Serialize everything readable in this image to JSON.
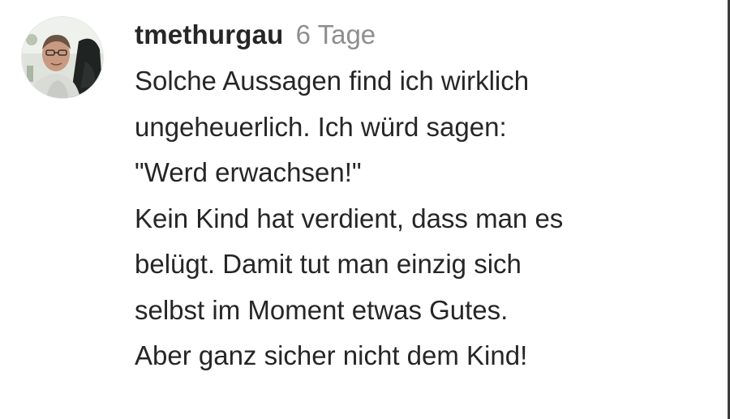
{
  "comment": {
    "username": "tmethurgau",
    "timestamp": "6 Tage",
    "avatar_icon": "user-avatar-photo",
    "text_lines": [
      "Solche Aussagen find ich wirklich",
      "ungeheuerlich. Ich würd sagen:",
      "\"Werd erwachsen!\"",
      "Kein Kind hat verdient, dass man es",
      "belügt. Damit tut man einzig sich",
      "selbst im Moment etwas Gutes.",
      "Aber ganz sicher nicht dem Kind!"
    ]
  },
  "colors": {
    "text": "#262626",
    "muted": "#8e8e8e",
    "background": "#ffffff"
  }
}
